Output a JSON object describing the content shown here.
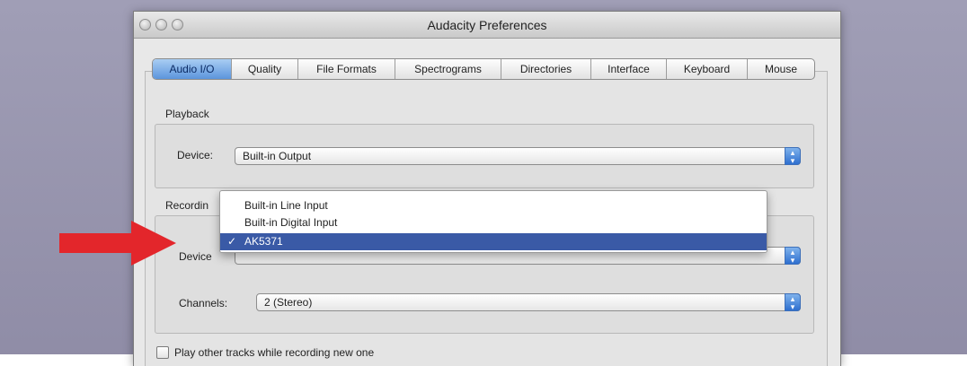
{
  "window": {
    "title": "Audacity Preferences"
  },
  "tabs": [
    {
      "label": "Audio I/O",
      "active": true
    },
    {
      "label": "Quality",
      "active": false
    },
    {
      "label": "File Formats",
      "active": false
    },
    {
      "label": "Spectrograms",
      "active": false
    },
    {
      "label": "Directories",
      "active": false
    },
    {
      "label": "Interface",
      "active": false
    },
    {
      "label": "Keyboard",
      "active": false
    },
    {
      "label": "Mouse",
      "active": false
    }
  ],
  "playback": {
    "group_label": "Playback",
    "device_label": "Device:",
    "device_value": "Built-in Output"
  },
  "recording": {
    "group_label": "Recordin",
    "device_label": "Device",
    "channels_label": "Channels:",
    "channels_value": "2 (Stereo)",
    "menu_options": [
      {
        "label": "Built-in Line Input",
        "selected": false
      },
      {
        "label": "Built-in Digital Input",
        "selected": false
      },
      {
        "label": "AK5371",
        "selected": true
      }
    ],
    "check_mark": "✓"
  },
  "options": {
    "play_other_tracks_label": "Play other tracks while recording new one"
  },
  "colors": {
    "highlight": "#3a5aa6",
    "arrow": "#e3262b",
    "active_tab": "#5c95dc"
  },
  "icons": {
    "stepper": "up-down-arrows-icon",
    "arrow": "red-pointer-arrow"
  }
}
